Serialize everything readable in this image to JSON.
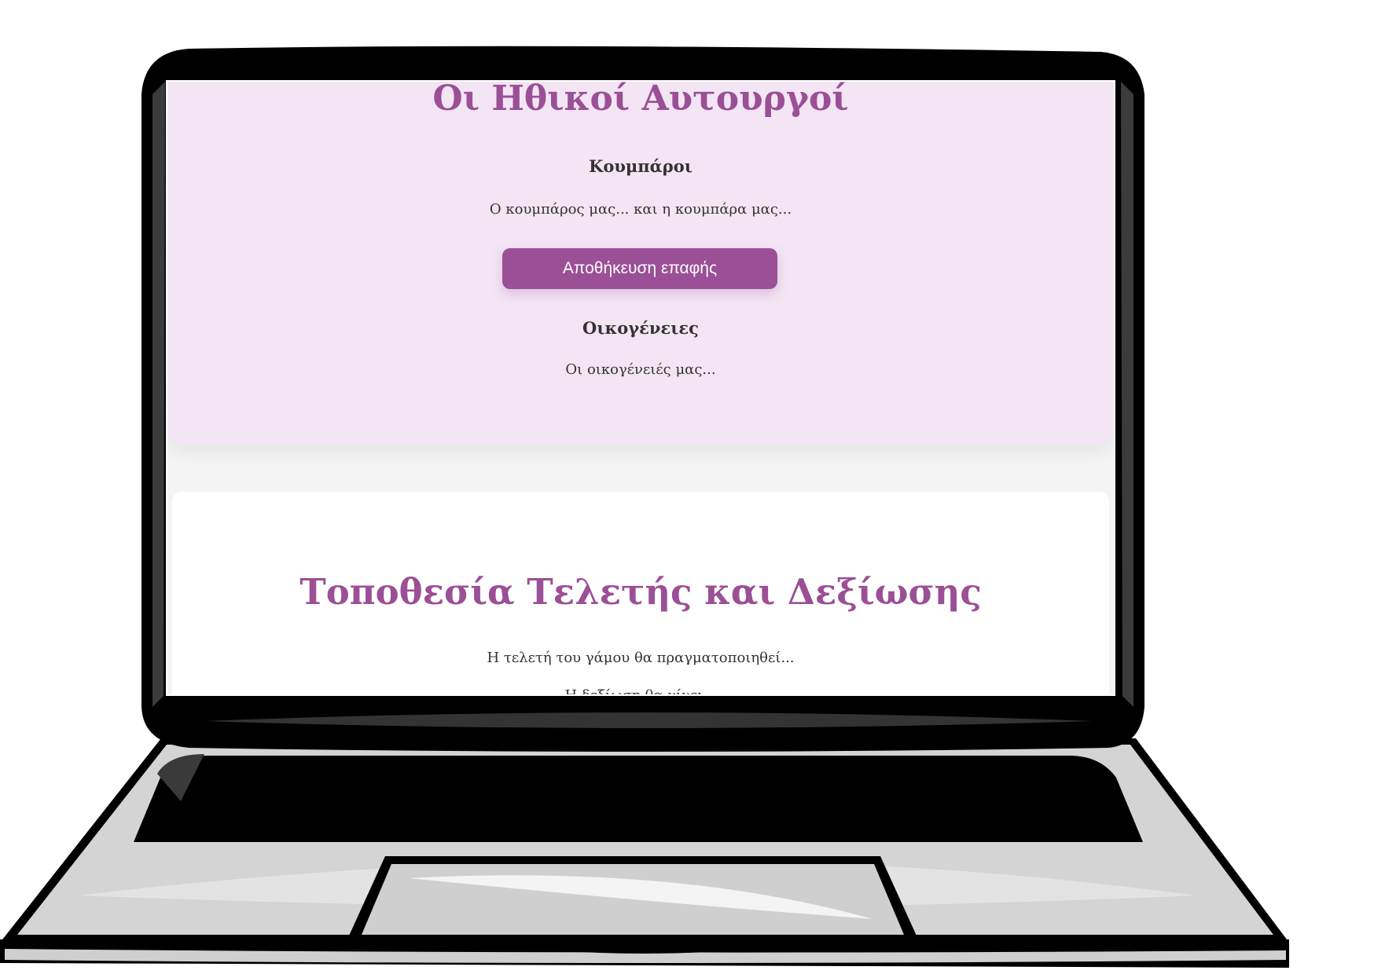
{
  "moral_section": {
    "title": "Οι Ηθικοί Αυτουργοί",
    "godparents_heading": "Κουμπάροι",
    "godparents_text": "Ο κουμπάρος μας... και η κουμπάρα μας...",
    "save_contact_label": "Αποθήκευση επαφής",
    "families_heading": "Οικογένειες",
    "families_text": "Οι οικογένειές μας..."
  },
  "location_section": {
    "title": "Τοποθεσία Τελετής και Δεξίωσης",
    "ceremony_text": "Η τελετή του γάμου θα πραγματοποιηθεί...",
    "reception_text": "Η δεξίωση θα γίνει..."
  },
  "colors": {
    "accent": "#9b4f96",
    "section_bg": "#f3e5f4",
    "page_bg": "#f4f4f4",
    "text": "#333333"
  }
}
